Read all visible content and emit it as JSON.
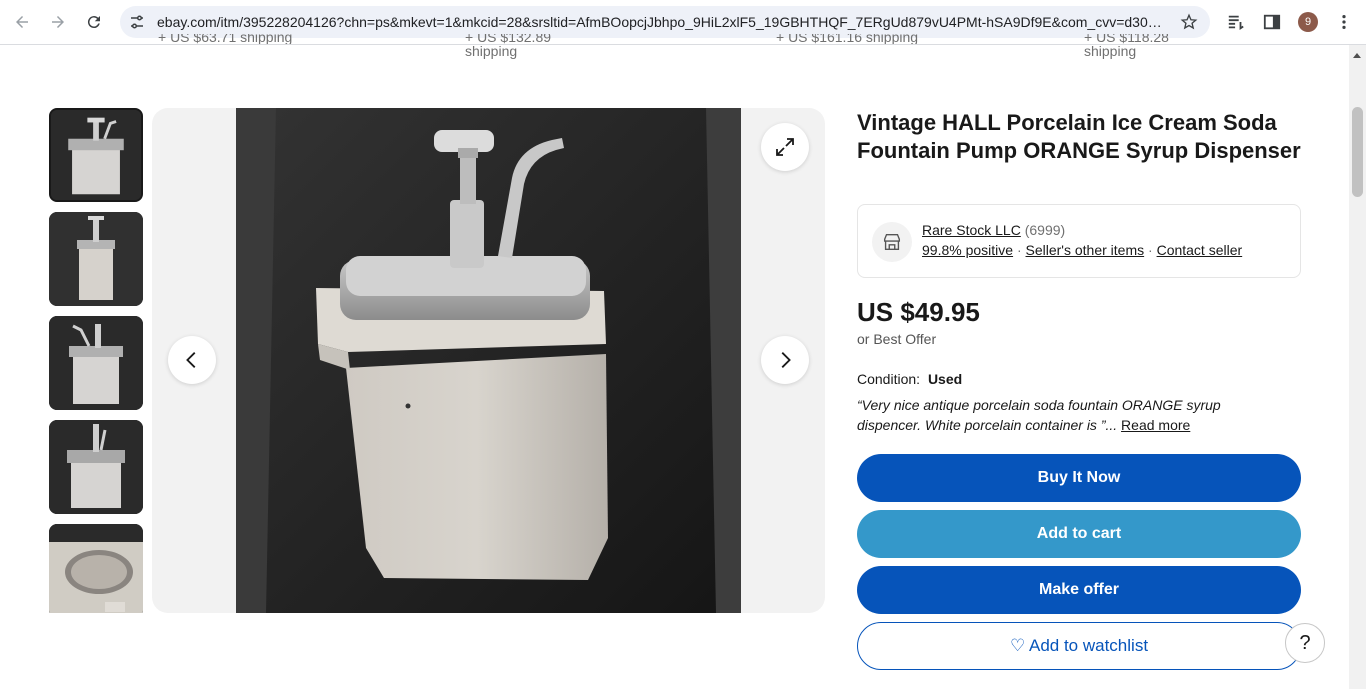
{
  "browser": {
    "url": "ebay.com/itm/395228204126?chn=ps&mkevt=1&mkcid=28&srsltid=AfmBOopcjJbhpo_9HiL2xlF5_19GBHTHQF_7ERgUd879vU4PMt-hSA9Df9E&com_cvv=d30042...",
    "profile_initial": "9"
  },
  "shipping_strip": [
    {
      "line1": "+ US $63.71 shipping",
      "line2": ""
    },
    {
      "line1": "+ US $132.89",
      "line2": "shipping"
    },
    {
      "line1": "+ US $161.16 shipping",
      "line2": ""
    },
    {
      "line1": "+ US $118.28",
      "line2": "shipping"
    }
  ],
  "listing": {
    "title": "Vintage HALL Porcelain Ice Cream Soda Fountain Pump ORANGE Syrup Dispenser",
    "seller": {
      "name": "Rare Stock LLC",
      "feedback_count": "(6999)",
      "positive": "99.8% positive",
      "other_items": "Seller's other items",
      "contact": "Contact seller",
      "separator": "·"
    },
    "price": "US $49.95",
    "best_offer": "or Best Offer",
    "condition_label": "Condition:",
    "condition_value": "Used",
    "description_snippet": "“Very nice antique porcelain soda fountain ORANGE syrup dispencer. White porcelain container is ”...",
    "read_more": "Read more"
  },
  "actions": {
    "buy_now": "Buy It Now",
    "add_to_cart": "Add to cart",
    "make_offer": "Make offer",
    "watchlist": "♡ Add to watchlist",
    "help": "?"
  },
  "colors": {
    "primary_blue": "#0654ba",
    "cart_blue": "#3498ca"
  }
}
